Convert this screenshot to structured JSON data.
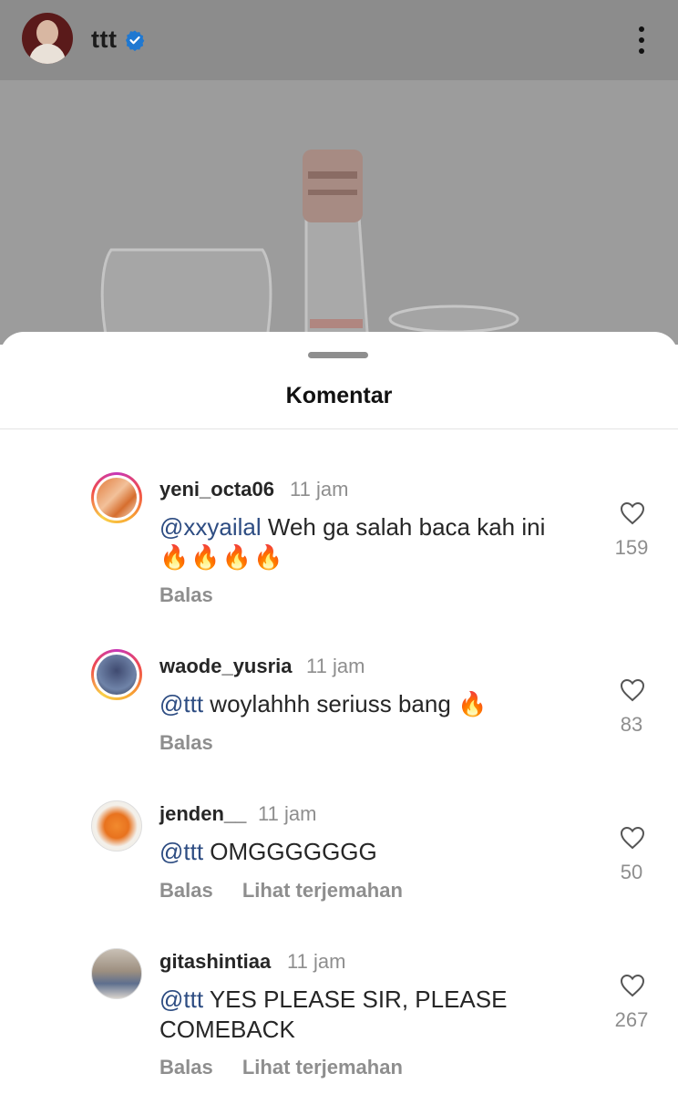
{
  "post": {
    "username": "ttt",
    "verified": true,
    "icons": {
      "verified": "verified-badge-icon",
      "more": "more-vertical-icon"
    }
  },
  "sheet": {
    "title": "Komentar"
  },
  "comments": [
    {
      "username": "yeni_octa06",
      "time": "11 jam",
      "mention": "@xxyailal",
      "text": " Weh ga salah baca kah ini",
      "emoji": "🔥🔥🔥🔥",
      "likes": "159",
      "actions": [
        "Balas"
      ]
    },
    {
      "username": "waode_yusria",
      "time": "11 jam",
      "mention": "@ttt",
      "text": " woylahhh seriuss bang 🔥",
      "likes": "83",
      "actions": [
        "Balas"
      ]
    },
    {
      "username": "jenden__",
      "time": "11 jam",
      "mention": "@ttt",
      "text": " OMGGGGGGG",
      "likes": "50",
      "actions": [
        "Balas",
        "Lihat terjemahan"
      ]
    },
    {
      "username": "gitashintiaa",
      "time": "11 jam",
      "mention": "@ttt",
      "text": " YES PLEASE SIR, PLEASE COMEBACK",
      "likes": "267",
      "actions": [
        "Balas",
        "Lihat terjemahan"
      ]
    }
  ],
  "colors": {
    "mention": "#2d4c82",
    "verified": "#1a73e8",
    "muted": "#8e8e8e"
  }
}
